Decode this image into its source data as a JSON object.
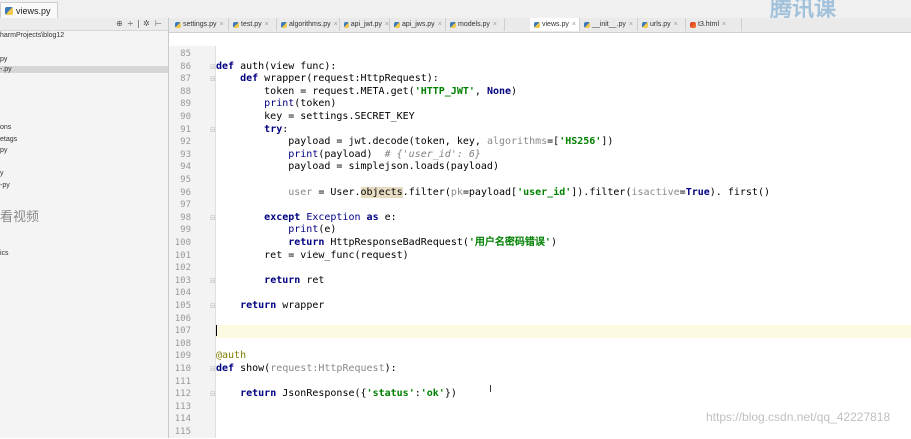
{
  "window": {
    "file_tab": "views.py",
    "watermark_logo": "腾讯课"
  },
  "sidebar": {
    "toolbar": [
      "⊕",
      "÷",
      "|",
      "✲",
      "⊢"
    ],
    "items": [
      {
        "label": "harmProjects\\blog12"
      },
      {
        "label": "py"
      },
      {
        "label": "-.py",
        "selected": true
      },
      {
        "label": "ons"
      },
      {
        "label": "etags"
      },
      {
        "label": "py"
      },
      {
        "label": "y"
      },
      {
        "label": "-py"
      },
      {
        "label": "ics"
      }
    ],
    "overlay_text": "看视频"
  },
  "tabs": [
    {
      "label": "settings.py"
    },
    {
      "label": "test.py"
    },
    {
      "label": "algorithms.py"
    },
    {
      "label": "api_jwt.py"
    },
    {
      "label": "api_jws.py"
    },
    {
      "label": "models.py"
    },
    {
      "label": "views.py",
      "active": true
    },
    {
      "label": "__init__.py"
    },
    {
      "label": "urls.py"
    },
    {
      "label": "t3.html"
    }
  ],
  "editor": {
    "lines": [
      {
        "n": "85",
        "tokens": []
      },
      {
        "n": "86",
        "tokens": [
          [
            "kw",
            "def "
          ],
          [
            "",
            "auth(view func):"
          ]
        ]
      },
      {
        "n": "87",
        "tokens": [
          [
            "",
            "    "
          ],
          [
            "kw",
            "def "
          ],
          [
            "",
            "wrapper(request:HttpRequest):"
          ]
        ]
      },
      {
        "n": "88",
        "tokens": [
          [
            "",
            "        token = request.META.get("
          ],
          [
            "str",
            "'HTTP_JWT'"
          ],
          [
            "",
            ", "
          ],
          [
            "kw",
            "None"
          ],
          [
            "",
            ")"
          ]
        ]
      },
      {
        "n": "89",
        "tokens": [
          [
            "",
            "        "
          ],
          [
            "bi",
            "print"
          ],
          [
            "",
            "(token)"
          ]
        ]
      },
      {
        "n": "90",
        "tokens": [
          [
            "",
            "        key = settings.SECRET_KEY"
          ]
        ]
      },
      {
        "n": "91",
        "tokens": [
          [
            "",
            "        "
          ],
          [
            "kw",
            "try"
          ],
          [
            "",
            ":"
          ]
        ]
      },
      {
        "n": "92",
        "tokens": [
          [
            "",
            "            payload = jwt.decode(token, key, "
          ],
          [
            "warn",
            "algorithms"
          ],
          [
            "",
            "=["
          ],
          [
            "str",
            "'HS256'"
          ],
          [
            "",
            "])"
          ]
        ]
      },
      {
        "n": "93",
        "tokens": [
          [
            "",
            "            "
          ],
          [
            "bi",
            "print"
          ],
          [
            "",
            "(payload)  "
          ],
          [
            "cm",
            "# {'user_id': 6}"
          ]
        ]
      },
      {
        "n": "94",
        "tokens": [
          [
            "",
            "            payload = simplejson.loads(payload)"
          ]
        ]
      },
      {
        "n": "95",
        "tokens": []
      },
      {
        "n": "96",
        "tokens": [
          [
            "",
            "            "
          ],
          [
            "warn",
            "user"
          ],
          [
            "",
            " = User."
          ],
          [
            "hl",
            "objects"
          ],
          [
            "",
            ".filter("
          ],
          [
            "warn",
            "pk"
          ],
          [
            "",
            "=payload["
          ],
          [
            "str",
            "'user_id'"
          ],
          [
            "",
            "]).filter("
          ],
          [
            "warn",
            "isactive"
          ],
          [
            "",
            "="
          ],
          [
            "kw",
            "True"
          ],
          [
            "",
            "). first()"
          ]
        ]
      },
      {
        "n": "97",
        "tokens": []
      },
      {
        "n": "98",
        "tokens": [
          [
            "",
            "        "
          ],
          [
            "kw",
            "except "
          ],
          [
            "bi",
            "Exception "
          ],
          [
            "kw",
            "as "
          ],
          [
            "",
            "e:"
          ]
        ]
      },
      {
        "n": "99",
        "tokens": [
          [
            "",
            "            "
          ],
          [
            "bi",
            "print"
          ],
          [
            "",
            "(e)"
          ]
        ]
      },
      {
        "n": "100",
        "tokens": [
          [
            "",
            "            "
          ],
          [
            "kw",
            "return "
          ],
          [
            "",
            "HttpResponseBadRequest("
          ],
          [
            "str",
            "'用户名密码错误'"
          ],
          [
            "",
            ")"
          ]
        ]
      },
      {
        "n": "101",
        "tokens": [
          [
            "",
            "        ret = view_func(request)"
          ]
        ]
      },
      {
        "n": "102",
        "tokens": []
      },
      {
        "n": "103",
        "tokens": [
          [
            "",
            "        "
          ],
          [
            "kw",
            "return "
          ],
          [
            "",
            "ret"
          ]
        ]
      },
      {
        "n": "104",
        "tokens": []
      },
      {
        "n": "105",
        "tokens": [
          [
            "",
            "    "
          ],
          [
            "kw",
            "return "
          ],
          [
            "",
            "wrapper"
          ]
        ]
      },
      {
        "n": "106",
        "tokens": []
      },
      {
        "n": "107",
        "tokens": [],
        "current": true
      },
      {
        "n": "108",
        "tokens": []
      },
      {
        "n": "109",
        "tokens": [
          [
            "dec",
            "@auth"
          ]
        ]
      },
      {
        "n": "110",
        "tokens": [
          [
            "kw",
            "def "
          ],
          [
            "",
            "show("
          ],
          [
            "warn",
            "request:HttpRequest"
          ],
          [
            "",
            "):"
          ]
        ]
      },
      {
        "n": "111",
        "tokens": []
      },
      {
        "n": "112",
        "tokens": [
          [
            "",
            "    "
          ],
          [
            "kw",
            "return "
          ],
          [
            "",
            "JsonResponse({"
          ],
          [
            "str",
            "'status'"
          ],
          [
            "",
            ":"
          ],
          [
            "str",
            "'ok'"
          ],
          [
            "",
            "})"
          ]
        ]
      },
      {
        "n": "113",
        "tokens": []
      },
      {
        "n": "114",
        "tokens": []
      },
      {
        "n": "115",
        "tokens": []
      }
    ]
  },
  "footer_watermark": "https://blog.csdn.net/qq_42227818"
}
